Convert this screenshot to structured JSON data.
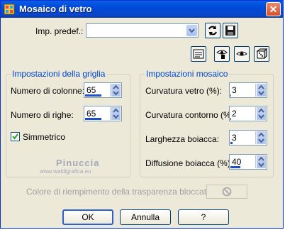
{
  "window": {
    "title": "Mosaico di vetro",
    "close_symbol": "✕"
  },
  "preset": {
    "label": "Imp. predef.:",
    "value": ""
  },
  "grid_group": {
    "title": "Impostazioni della griglia",
    "columns_label": "Numero di colonne:",
    "columns_value": "65",
    "columns_level": 0.65,
    "rows_label": "Numero di righe:",
    "rows_value": "65",
    "rows_level": 0.65,
    "symmetric_label": "Simmetrico",
    "symmetric_checked": true
  },
  "mosaic_group": {
    "title": "Impostazioni mosaico",
    "curvature_label": "Curvatura vetro (%):",
    "curvature_value": "3",
    "curvature_level": 0.03,
    "edge_curvature_label": "Curvatura contorno (%):",
    "edge_curvature_value": "2",
    "edge_curvature_level": 0.02,
    "grout_width_label": "Larghezza boiacca:",
    "grout_width_value": "3",
    "grout_width_level": 0.08,
    "grout_diffusion_label": "Diffusione boiacca (%):",
    "grout_diffusion_value": "40",
    "grout_diffusion_level": 0.4
  },
  "watermark": {
    "line1": "Pinuccia",
    "line2": "www.waldigrafica.eu"
  },
  "fill_color_label": "Colore di riempimento della trasparenza bloccato:",
  "buttons": {
    "ok": "OK",
    "cancel": "Annulla",
    "help": "?"
  },
  "icons": [
    "window-app-icon",
    "refresh-preset-icon",
    "save-preset-icon",
    "options-icon",
    "eye-hand-icon",
    "eye-icon",
    "random-dice-icon",
    "disabled-no-symbol-icon"
  ],
  "colors": {
    "accent": "#0046d5",
    "titlebar": "#0049d9",
    "bar": "#1c4fc8"
  }
}
